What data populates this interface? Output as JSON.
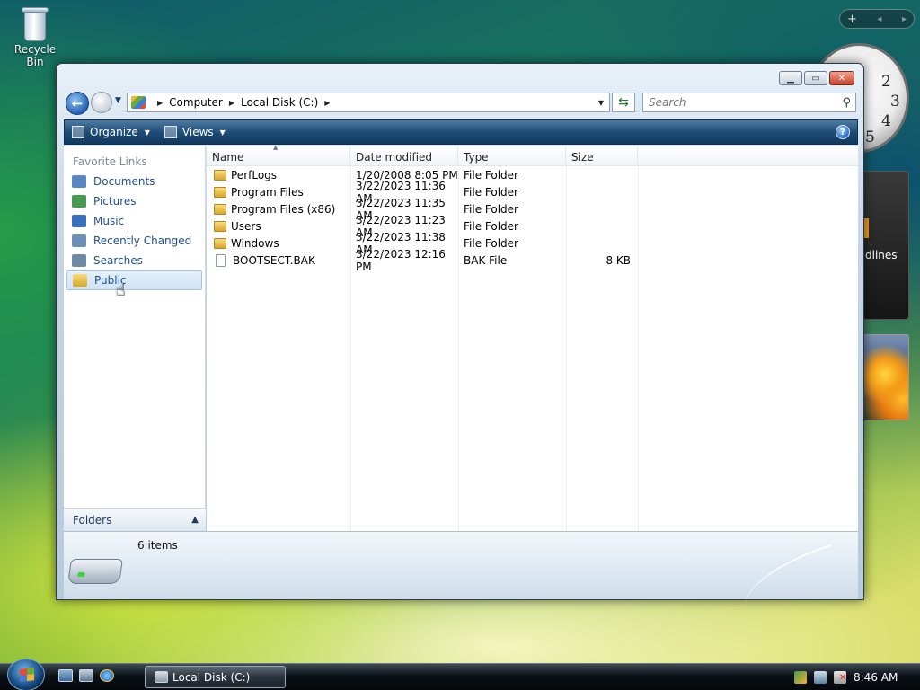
{
  "desktop": {
    "recycle_bin_label": "Recycle Bin",
    "news_gadget_text": "dlines",
    "gadget_controls": "+ ◂ ▸",
    "clock_numbers": [
      "2",
      "3",
      "4",
      "5"
    ]
  },
  "window": {
    "breadcrumb": [
      "Computer",
      "Local Disk (C:)"
    ],
    "search_placeholder": "Search",
    "toolbar": {
      "organize_label": "Organize",
      "views_label": "Views",
      "help_label": "?"
    },
    "nav_pane": {
      "header": "Favorite Links",
      "items": [
        {
          "label": "Documents",
          "icon": "documents-icon",
          "color": "#5a86c4"
        },
        {
          "label": "Pictures",
          "icon": "pictures-icon",
          "color": "#4a9a52"
        },
        {
          "label": "Music",
          "icon": "music-icon",
          "color": "#3a6fb9"
        },
        {
          "label": "Recently Changed",
          "icon": "recently-changed-icon",
          "color": "#6b8fb6"
        },
        {
          "label": "Searches",
          "icon": "searches-icon",
          "color": "#6f8aa5"
        },
        {
          "label": "Public",
          "icon": "public-folder-icon",
          "color": "#e9bd45",
          "selected": true
        }
      ],
      "folders_label": "Folders"
    },
    "columns": [
      "Name",
      "Date modified",
      "Type",
      "Size"
    ],
    "files": [
      {
        "name": "PerfLogs",
        "date": "1/20/2008 8:05 PM",
        "type": "File Folder",
        "size": "",
        "icon": "folder-icon"
      },
      {
        "name": "Program Files",
        "date": "3/22/2023 11:36 AM",
        "type": "File Folder",
        "size": "",
        "icon": "folder-icon"
      },
      {
        "name": "Program Files (x86)",
        "date": "3/22/2023 11:35 AM",
        "type": "File Folder",
        "size": "",
        "icon": "folder-icon"
      },
      {
        "name": "Users",
        "date": "3/22/2023 11:23 AM",
        "type": "File Folder",
        "size": "",
        "icon": "folder-icon"
      },
      {
        "name": "Windows",
        "date": "3/22/2023 11:38 AM",
        "type": "File Folder",
        "size": "",
        "icon": "folder-icon"
      },
      {
        "name": "BOOTSECT.BAK",
        "date": "3/22/2023 12:16 PM",
        "type": "BAK File",
        "size": "8 KB",
        "icon": "file-icon"
      }
    ],
    "details": {
      "item_count": "6 items"
    }
  },
  "taskbar": {
    "task_label": "Local Disk (C:)",
    "clock": "8:46 AM"
  }
}
